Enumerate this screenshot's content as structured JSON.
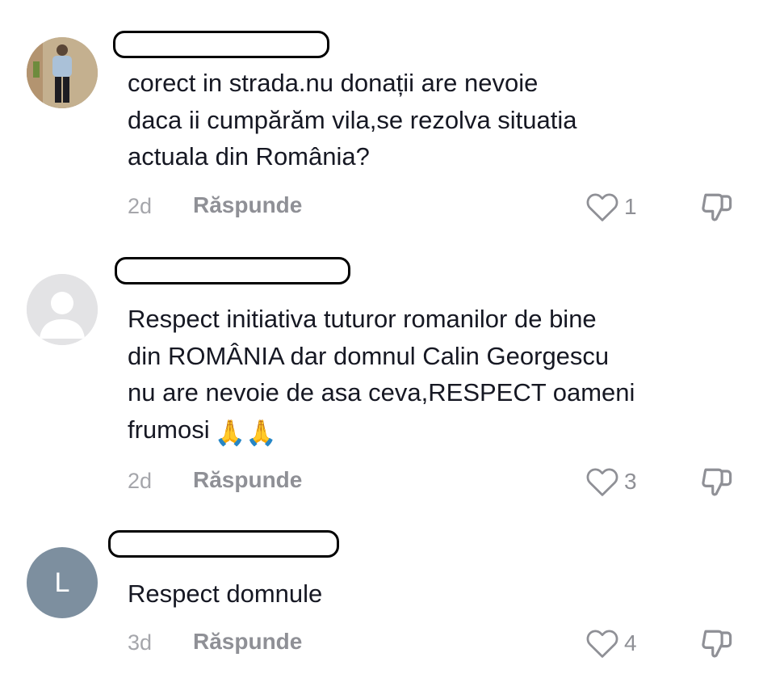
{
  "comments": [
    {
      "text": "corect in strada.nu donații are nevoie\ndaca ii cumpărăm vila,se rezolva situatia\nactuala din România?",
      "time": "2d",
      "reply_label": "Răspunde",
      "likes": "1",
      "avatar": "photo"
    },
    {
      "text": "Respect initiativa tuturor romanilor de bine\ndin ROMÂNIA dar domnul Calin Georgescu\nnu are nevoie de asa ceva,RESPECT oameni\nfrumosi",
      "emoji": "🙏🙏",
      "time": "2d",
      "reply_label": "Răspunde",
      "likes": "3",
      "avatar": "default"
    },
    {
      "text": "Respect domnule",
      "time": "3d",
      "reply_label": "Răspunde",
      "likes": "4",
      "avatar": "letter",
      "avatar_letter": "L"
    }
  ],
  "colors": {
    "text": "#161823",
    "meta": "#a5a6ab",
    "reply": "#8f9096",
    "icon": "#8f9096"
  },
  "icons": {
    "like": "heart-outline-icon",
    "dislike": "thumbs-down-icon"
  }
}
